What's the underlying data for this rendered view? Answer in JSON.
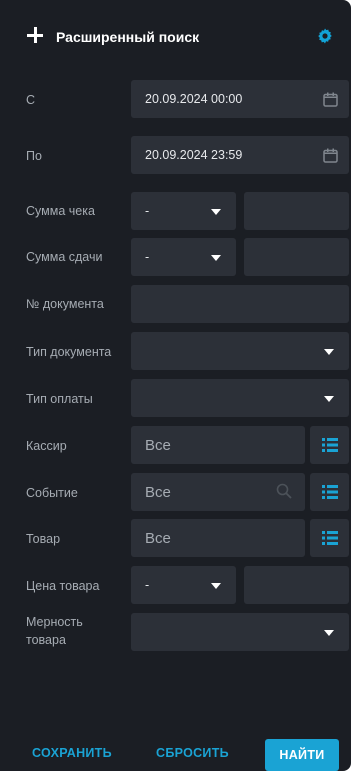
{
  "header": {
    "title": "Расширенный поиск",
    "add_icon": "plus-icon",
    "settings_icon": "gear-icon"
  },
  "filters": {
    "from": {
      "label": "С",
      "value": "20.09.2024 00:00",
      "icon": "calendar-icon"
    },
    "to": {
      "label": "По",
      "value": "20.09.2024 23:59",
      "icon": "calendar-icon"
    },
    "receipt_sum": {
      "label": "Сумма чека",
      "operator": "-",
      "value": ""
    },
    "change_sum": {
      "label": "Сумма сдачи",
      "operator": "-",
      "value": ""
    },
    "doc_number": {
      "label": "№ документа",
      "value": ""
    },
    "doc_type": {
      "label": "Тип документа",
      "value": ""
    },
    "payment_type": {
      "label": "Тип оплаты",
      "value": ""
    },
    "cashier": {
      "label": "Кассир",
      "placeholder": "Все"
    },
    "event": {
      "label": "Событие",
      "placeholder": "Все"
    },
    "product": {
      "label": "Товар",
      "placeholder": "Все"
    },
    "product_price": {
      "label": "Цена товара",
      "operator": "-",
      "value": ""
    },
    "product_unit": {
      "label_line1": "Мерность",
      "label_line2": "товара",
      "value": ""
    }
  },
  "footer": {
    "save": "СОХРАНИТЬ",
    "reset": "СБРОСИТЬ",
    "find": "НАЙТИ"
  },
  "colors": {
    "panel_bg": "#1b1e24",
    "field_bg": "#2c3038",
    "accent": "#1aa3d4",
    "label": "#a6acb3"
  }
}
